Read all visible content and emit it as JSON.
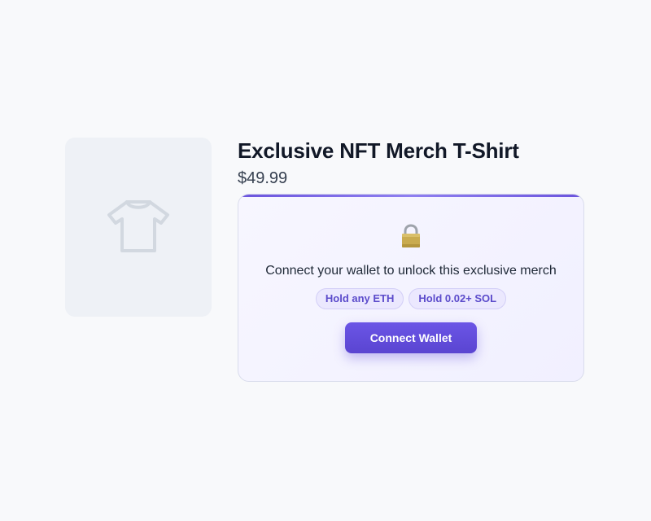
{
  "product": {
    "title": "Exclusive NFT Merch T-Shirt",
    "price": "$49.99",
    "image_icon": "tshirt-icon"
  },
  "token_gate": {
    "lock_icon": "lock-icon",
    "message": "Connect your wallet to unlock this exclusive merch",
    "requirements": [
      "Hold any ETH",
      "Hold 0.02+ SOL"
    ],
    "button_label": "Connect Wallet"
  },
  "colors": {
    "background": "#f8f9fb",
    "accent": "#5b4bd6",
    "title": "#111827",
    "badge_bg": "#ebe8fe",
    "badge_text": "#5b4bcb"
  }
}
